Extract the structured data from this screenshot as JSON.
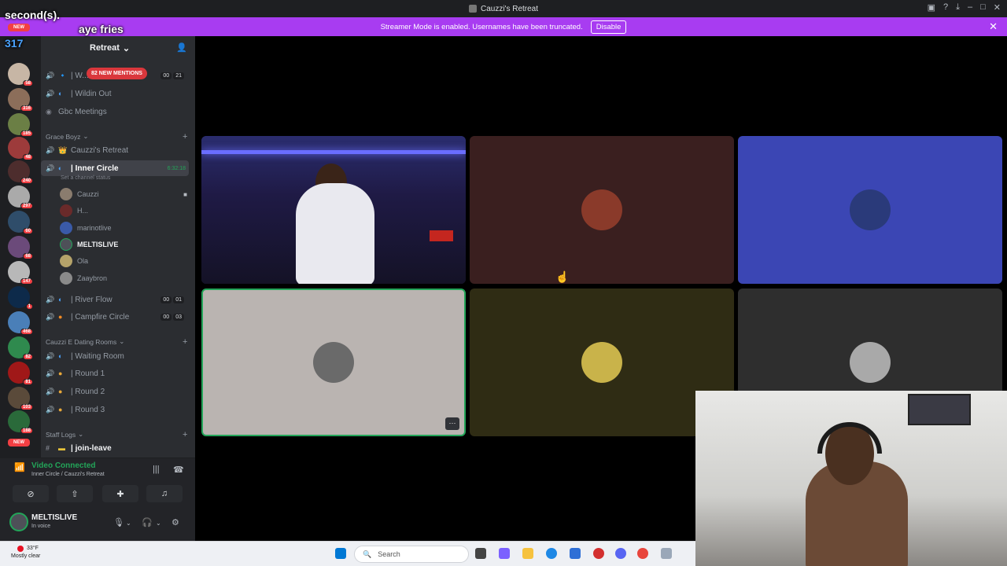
{
  "app": {
    "title": "Cauzzi's Retreat"
  },
  "banner": {
    "text": "Streamer Mode is enabled. Usernames have been truncated.",
    "disable_label": "Disable"
  },
  "chat_overlay": {
    "line1": "second(s).",
    "user": "",
    "message": "aye fries",
    "line3_prefix": "317"
  },
  "server_rail": {
    "badges": [
      "58",
      "316",
      "185",
      "48",
      "240",
      "297",
      "60",
      "68",
      "147",
      "1",
      "468",
      "82",
      "81",
      "103",
      "188"
    ],
    "new_label": "NEW"
  },
  "sidebar": {
    "server_name": "Retreat",
    "mentions": "82 NEW MENTIONS",
    "channels_top": [
      {
        "name": "| W...",
        "counts": [
          "00",
          "21"
        ]
      },
      {
        "name": "| Wildin Out"
      },
      {
        "name": "Gbc Meetings"
      }
    ],
    "cat_grace": "Grace Boyz",
    "ch_cauzzi": "Cauzzi's Retreat",
    "ch_inner": "| Inner Circle",
    "ch_inner_time": "6:32:18",
    "status_hint": "Set a channel status",
    "voice_users": [
      "Cauzzi",
      "H...",
      "marinotlive",
      "MELTISLIVE",
      "Ola",
      "Zaaybron"
    ],
    "ch_river": "| River Flow",
    "river_counts": [
      "00",
      "01"
    ],
    "ch_campfire": "| Campfire Circle",
    "campfire_counts": [
      "00",
      "03"
    ],
    "cat_dating": "Cauzzi E Dating Rooms",
    "ch_waiting": "| Waiting Room",
    "ch_round1": "| Round 1",
    "ch_round2": "| Round 2",
    "ch_round3": "| Round 3",
    "cat_staff": "Staff Logs",
    "ch_join": "| join-leave"
  },
  "voice_panel": {
    "connected": "Video Connected",
    "location": "Inner Circle / Cauzzi's Retreat"
  },
  "user_panel": {
    "name": "MELTISLIVE",
    "status": "In voice"
  },
  "taskbar": {
    "temp": "33°F",
    "weather": "Mostly clear",
    "search_placeholder": "Search"
  },
  "colors": {
    "accent": "#a83cf1",
    "online": "#23a559",
    "mention": "#da373c"
  }
}
